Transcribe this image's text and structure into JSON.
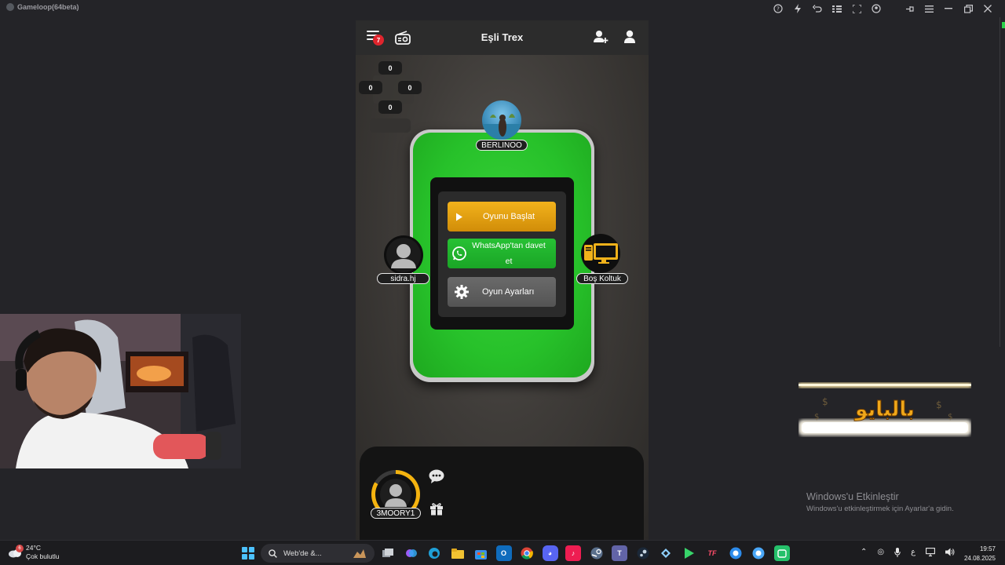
{
  "emulator": {
    "title": "Gameloop(64beta)"
  },
  "game": {
    "header": {
      "title": "Eşli Trex",
      "notification_count": "7"
    },
    "scores": {
      "top": "0",
      "left": "0",
      "right": "0",
      "bottom": "0"
    },
    "menu": {
      "start_label": "Oyunu Başlat",
      "whatsapp_label": "WhatsApp'tan davet et",
      "settings_label": "Oyun Ayarları"
    },
    "seats": {
      "top": "BERLINOO",
      "left": "sidra.hj",
      "right": "Boş Koltuk",
      "self": "3MOORY1"
    }
  },
  "overlay": {
    "activate_title": "Windows'u Etkinleştir",
    "activate_subtitle": "Windows'u etkinleştirmek için Ayarlar'a gidin.",
    "logo_text": "بالبايو"
  },
  "taskbar": {
    "weather_temp": "24°C",
    "weather_desc": "Çok bulutlu",
    "weather_badge": "6",
    "search_placeholder": "Web'de &...",
    "time": "19:57",
    "date": "24.08.2025",
    "ime": "ع"
  }
}
